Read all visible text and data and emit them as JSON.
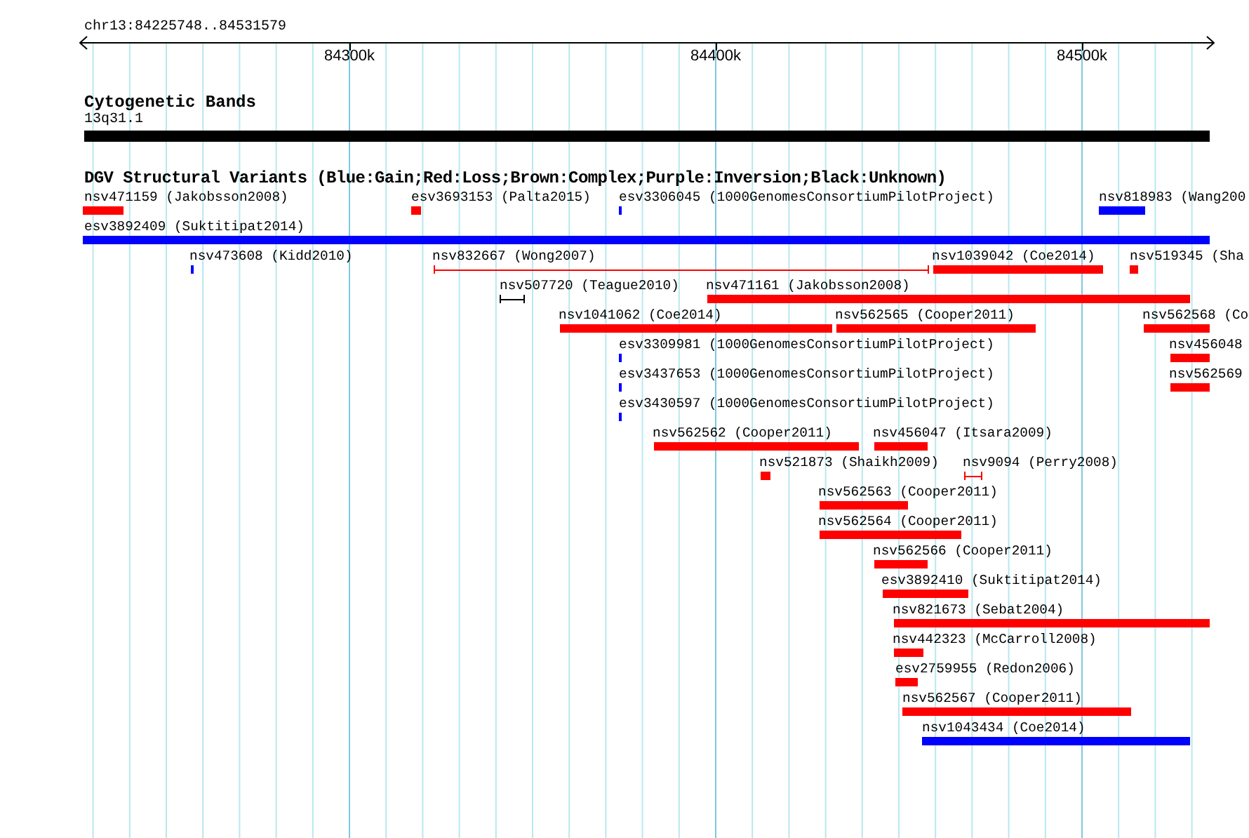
{
  "ruler": {
    "location": "chr13:84225748..84531579",
    "ticks": [
      "84300k",
      "84400k",
      "84500k"
    ]
  },
  "cytoband_track": {
    "title": "Cytogenetic Bands",
    "band": "13q31.1"
  },
  "variant_track": {
    "title": "DGV Structural Variants (Blue:Gain;Red:Loss;Brown:Complex;Purple:Inversion;Black:Unknown)",
    "features": [
      {
        "label": "nsv471159 (Jakobsson2008)",
        "color": "#ff0000",
        "kind": "bar"
      },
      {
        "label": "esv3693153 (Palta2015)",
        "color": "#ff0000",
        "kind": "bar"
      },
      {
        "label": "esv3306045 (1000GenomesConsortiumPilotProject)",
        "color": "#0000ff",
        "kind": "bar"
      },
      {
        "label": "nsv818983 (Wang200",
        "color": "#0000ff",
        "kind": "bar"
      },
      {
        "label": "esv3892409 (Suktitipat2014)",
        "color": "#0000ff",
        "kind": "bar"
      },
      {
        "label": "nsv473608 (Kidd2010)",
        "color": "#0000ff",
        "kind": "bar"
      },
      {
        "label": "nsv832667 (Wong2007)",
        "color": "#ff0000",
        "kind": "span"
      },
      {
        "label": "nsv1039042 (Coe2014)",
        "color": "#ff0000",
        "kind": "bar"
      },
      {
        "label": "nsv519345 (Sha",
        "color": "#ff0000",
        "kind": "bar"
      },
      {
        "label": "nsv507720 (Teague2010)",
        "color": "#000000",
        "kind": "span"
      },
      {
        "label": "nsv471161 (Jakobsson2008)",
        "color": "#ff0000",
        "kind": "bar"
      },
      {
        "label": "nsv1041062 (Coe2014)",
        "color": "#ff0000",
        "kind": "bar"
      },
      {
        "label": "nsv562565 (Cooper2011)",
        "color": "#ff0000",
        "kind": "bar"
      },
      {
        "label": "nsv562568 (Co",
        "color": "#ff0000",
        "kind": "bar"
      },
      {
        "label": "esv3309981 (1000GenomesConsortiumPilotProject)",
        "color": "#0000ff",
        "kind": "bar"
      },
      {
        "label": "nsv456048",
        "color": "#ff0000",
        "kind": "bar"
      },
      {
        "label": "esv3437653 (1000GenomesConsortiumPilotProject)",
        "color": "#0000ff",
        "kind": "bar"
      },
      {
        "label": "nsv562569",
        "color": "#ff0000",
        "kind": "bar"
      },
      {
        "label": "esv3430597 (1000GenomesConsortiumPilotProject)",
        "color": "#0000ff",
        "kind": "bar"
      },
      {
        "label": "nsv562562 (Cooper2011)",
        "color": "#ff0000",
        "kind": "bar"
      },
      {
        "label": "nsv456047 (Itsara2009)",
        "color": "#ff0000",
        "kind": "bar"
      },
      {
        "label": "nsv521873 (Shaikh2009)",
        "color": "#ff0000",
        "kind": "bar"
      },
      {
        "label": "nsv9094 (Perry2008)",
        "color": "#ff0000",
        "kind": "span"
      },
      {
        "label": "nsv562563 (Cooper2011)",
        "color": "#ff0000",
        "kind": "bar"
      },
      {
        "label": "nsv562564 (Cooper2011)",
        "color": "#ff0000",
        "kind": "bar"
      },
      {
        "label": "nsv562566 (Cooper2011)",
        "color": "#ff0000",
        "kind": "bar"
      },
      {
        "label": "esv3892410 (Suktitipat2014)",
        "color": "#ff0000",
        "kind": "bar"
      },
      {
        "label": "nsv821673 (Sebat2004)",
        "color": "#ff0000",
        "kind": "bar"
      },
      {
        "label": "nsv442323 (McCarroll2008)",
        "color": "#ff0000",
        "kind": "bar"
      },
      {
        "label": "esv2759955 (Redon2006)",
        "color": "#ff0000",
        "kind": "bar"
      },
      {
        "label": "nsv562567 (Cooper2011)",
        "color": "#ff0000",
        "kind": "bar"
      },
      {
        "label": "nsv1043434 (Coe2014)",
        "color": "#0000ff",
        "kind": "bar"
      }
    ]
  }
}
